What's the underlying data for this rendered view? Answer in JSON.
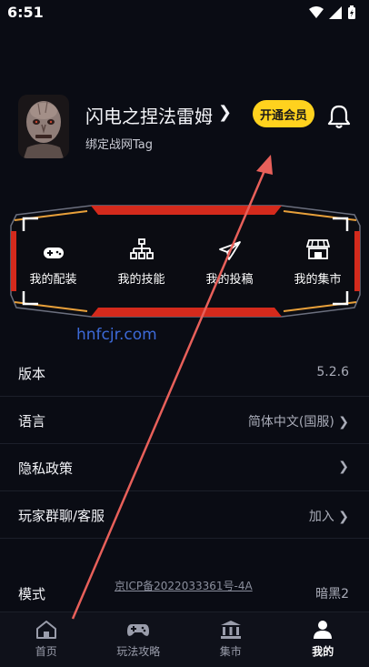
{
  "status_bar": {
    "time": "6:51"
  },
  "profile": {
    "username": "闪电之捏法雷姆",
    "bind_tag": "绑定战网Tag",
    "vip_button": "开通会员"
  },
  "quick_actions": [
    {
      "label": "我的配装",
      "icon": "gamepad-icon"
    },
    {
      "label": "我的技能",
      "icon": "skill-tree-icon"
    },
    {
      "label": "我的投稿",
      "icon": "paper-plane-icon"
    },
    {
      "label": "我的集市",
      "icon": "market-icon"
    }
  ],
  "watermark": "hnfcjr.com",
  "settings": [
    {
      "label": "版本",
      "value": "5.2.6"
    },
    {
      "label": "语言",
      "value": "简体中文(国服) ❯"
    },
    {
      "label": "隐私政策",
      "value": "❯"
    },
    {
      "label": "玩家群聊/客服",
      "value": "加入 ❯"
    }
  ],
  "mode": {
    "label": "模式",
    "icp": "京ICP备2022033361号-4A",
    "value": "暗黑2"
  },
  "tabs": [
    {
      "label": "首页",
      "icon": "home-icon",
      "active": false
    },
    {
      "label": "玩法攻略",
      "icon": "gamepad-icon",
      "active": false
    },
    {
      "label": "集市",
      "icon": "bank-icon",
      "active": false
    },
    {
      "label": "我的",
      "icon": "person-icon",
      "active": true
    }
  ],
  "colors": {
    "accent": "#ffd21e",
    "panel_red": "#d42a1c",
    "arrow": "#e8605a",
    "watermark": "#3d6ad8"
  }
}
